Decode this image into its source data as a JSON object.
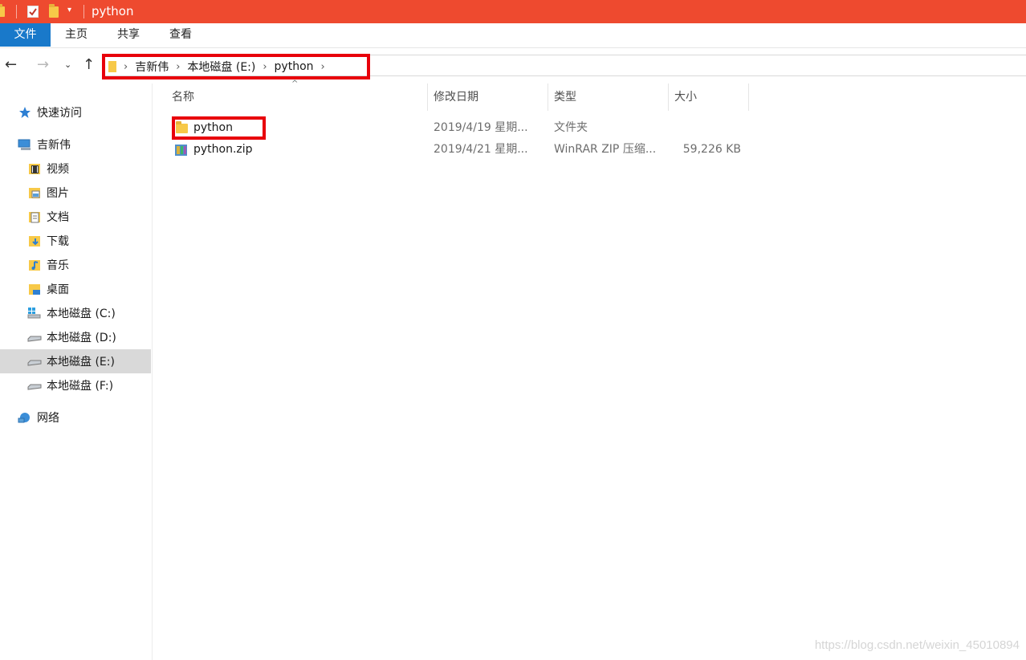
{
  "window": {
    "title": "python"
  },
  "ribbon": {
    "tabs": [
      "文件",
      "主页",
      "共享",
      "查看"
    ]
  },
  "address": {
    "crumbs": [
      "吉新伟",
      "本地磁盘 (E:)",
      "python"
    ]
  },
  "sidebar": {
    "quick_access": "快速访问",
    "pc": "吉新伟",
    "items": [
      "视频",
      "图片",
      "文档",
      "下载",
      "音乐",
      "桌面",
      "本地磁盘 (C:)",
      "本地磁盘 (D:)",
      "本地磁盘 (E:)",
      "本地磁盘 (F:)"
    ],
    "network": "网络"
  },
  "columns": [
    "名称",
    "修改日期",
    "类型",
    "大小"
  ],
  "files": [
    {
      "name": "python",
      "date": "2019/4/19 星期...",
      "type": "文件夹",
      "size": ""
    },
    {
      "name": "python.zip",
      "date": "2019/4/21 星期...",
      "type": "WinRAR ZIP 压缩...",
      "size": "59,226 KB"
    }
  ],
  "watermark": "https://blog.csdn.net/weixin_45010894",
  "colors": {
    "titlebar": "#ee4a2f",
    "file_tab": "#1979ca",
    "highlight": "#e8000b",
    "selected": "#d9d9d9"
  }
}
